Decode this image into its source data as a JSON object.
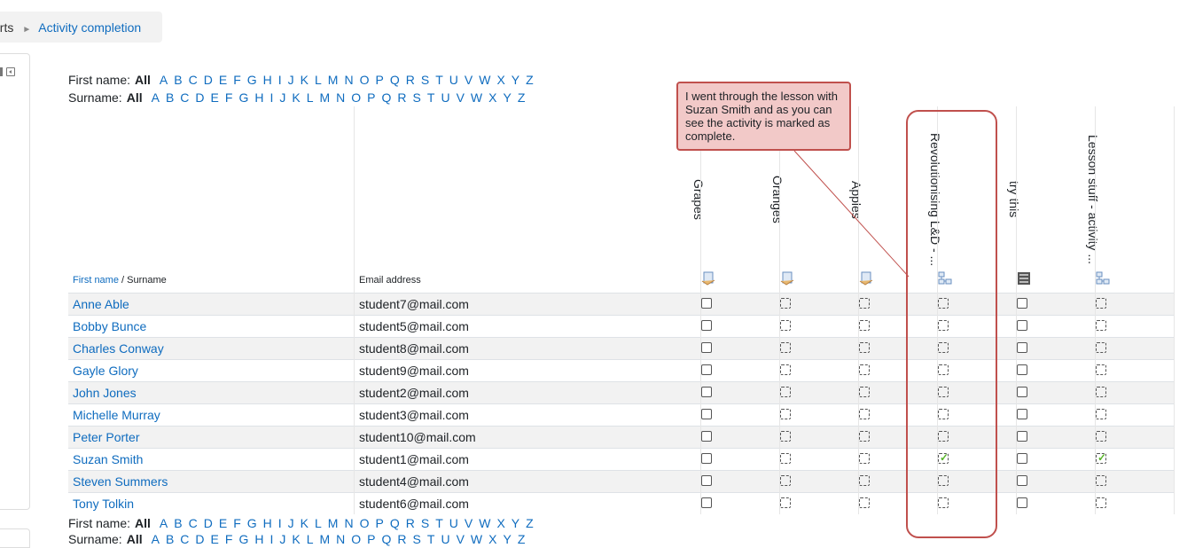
{
  "breadcrumb": {
    "prev": "orts",
    "current": "Activity completion"
  },
  "filters": {
    "firstname_label": "First name:",
    "surname_label": "Surname:",
    "all": "All",
    "letters": [
      "A",
      "B",
      "C",
      "D",
      "E",
      "F",
      "G",
      "H",
      "I",
      "J",
      "K",
      "L",
      "M",
      "N",
      "O",
      "P",
      "Q",
      "R",
      "S",
      "T",
      "U",
      "V",
      "W",
      "X",
      "Y",
      "Z"
    ]
  },
  "table": {
    "header_firstname": "First name",
    "header_sep": " / ",
    "header_surname": "Surname",
    "header_email": "Email address",
    "activities": [
      {
        "name": "Grapes",
        "icon": "assign-icon",
        "mode": "manual"
      },
      {
        "name": "Oranges",
        "icon": "assign-icon",
        "mode": "auto"
      },
      {
        "name": "Apples",
        "icon": "assign-icon",
        "mode": "auto"
      },
      {
        "name": "Revolutionising L&D - ...",
        "icon": "lesson-icon",
        "mode": "auto"
      },
      {
        "name": "try this",
        "icon": "quiz-icon",
        "mode": "manual"
      },
      {
        "name": "Lesson stuff - activity ...",
        "icon": "lesson-icon",
        "mode": "auto"
      }
    ],
    "rows": [
      {
        "name": "Anne Able",
        "email": "student7@mail.com",
        "done": [
          false,
          false,
          false,
          false,
          false,
          false
        ]
      },
      {
        "name": "Bobby Bunce",
        "email": "student5@mail.com",
        "done": [
          false,
          false,
          false,
          false,
          false,
          false
        ]
      },
      {
        "name": "Charles Conway",
        "email": "student8@mail.com",
        "done": [
          false,
          false,
          false,
          false,
          false,
          false
        ]
      },
      {
        "name": "Gayle Glory",
        "email": "student9@mail.com",
        "done": [
          false,
          false,
          false,
          false,
          false,
          false
        ]
      },
      {
        "name": "John Jones",
        "email": "student2@mail.com",
        "done": [
          false,
          false,
          false,
          false,
          false,
          false
        ]
      },
      {
        "name": "Michelle Murray",
        "email": "student3@mail.com",
        "done": [
          false,
          false,
          false,
          false,
          false,
          false
        ]
      },
      {
        "name": "Peter Porter",
        "email": "student10@mail.com",
        "done": [
          false,
          false,
          false,
          false,
          false,
          false
        ]
      },
      {
        "name": "Suzan Smith",
        "email": "student1@mail.com",
        "done": [
          false,
          false,
          false,
          true,
          false,
          true
        ]
      },
      {
        "name": "Steven Summers",
        "email": "student4@mail.com",
        "done": [
          false,
          false,
          false,
          false,
          false,
          false
        ]
      },
      {
        "name": "Tony Tolkin",
        "email": "student6@mail.com",
        "done": [
          false,
          false,
          false,
          false,
          false,
          false
        ]
      }
    ]
  },
  "annotation": {
    "text": "I went through the lesson with Suzan Smith and as you can see the activity is marked as complete."
  },
  "colors": {
    "link": "#0f6cbf",
    "highlight": "#c0504d",
    "callout_bg": "#f2c9c8",
    "tick": "#5ab52b"
  }
}
